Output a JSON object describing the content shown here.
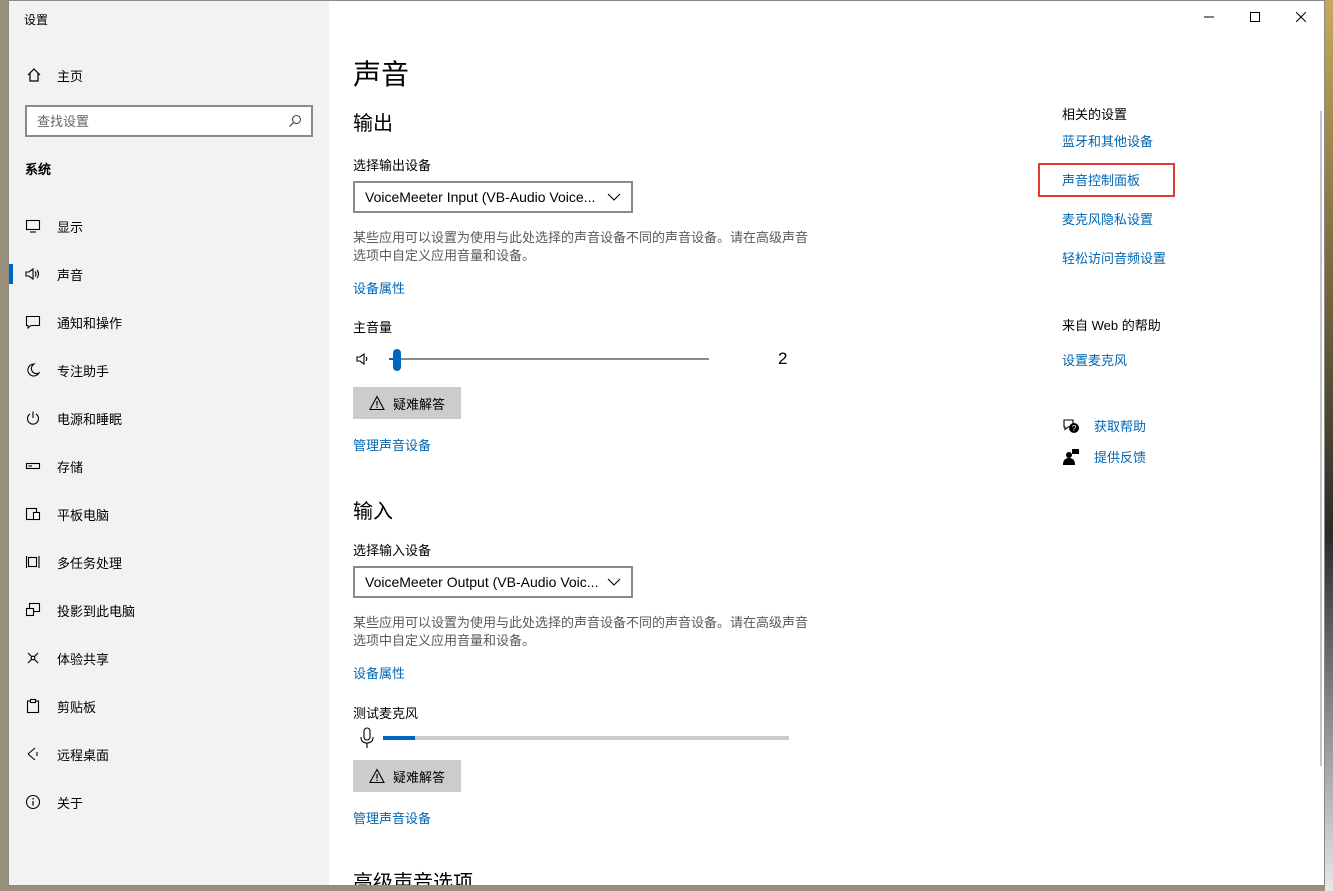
{
  "window": {
    "title": "设置",
    "minimize_icon": "minimize-icon",
    "maximize_icon": "maximize-icon",
    "close_icon": "close-icon"
  },
  "sidebar": {
    "home_label": "主页",
    "search_placeholder": "查找设置",
    "section_label": "系统",
    "items": [
      {
        "label": "显示",
        "icon": "display-icon"
      },
      {
        "label": "声音",
        "icon": "speaker-icon",
        "active": true
      },
      {
        "label": "通知和操作",
        "icon": "notification-icon"
      },
      {
        "label": "专注助手",
        "icon": "moon-icon"
      },
      {
        "label": "电源和睡眠",
        "icon": "power-icon"
      },
      {
        "label": "存储",
        "icon": "storage-icon"
      },
      {
        "label": "平板电脑",
        "icon": "tablet-icon"
      },
      {
        "label": "多任务处理",
        "icon": "multitask-icon"
      },
      {
        "label": "投影到此电脑",
        "icon": "project-icon"
      },
      {
        "label": "体验共享",
        "icon": "share-icon"
      },
      {
        "label": "剪贴板",
        "icon": "clipboard-icon"
      },
      {
        "label": "远程桌面",
        "icon": "remote-desktop-icon"
      },
      {
        "label": "关于",
        "icon": "info-icon"
      }
    ]
  },
  "main": {
    "page_title": "声音",
    "output": {
      "heading": "输出",
      "device_label": "选择输出设备",
      "device_value": "VoiceMeeter Input (VB-Audio Voice...",
      "description": "某些应用可以设置为使用与此处选择的声音设备不同的声音设备。请在高级声音选项中自定义应用音量和设备。",
      "device_properties": "设备属性",
      "master_volume_label": "主音量",
      "volume_value": "2",
      "volume_level_pct": 2,
      "troubleshoot": "疑难解答",
      "manage_devices": "管理声音设备"
    },
    "input": {
      "heading": "输入",
      "device_label": "选择输入设备",
      "device_value": "VoiceMeeter Output (VB-Audio Voic...",
      "description": "某些应用可以设置为使用与此处选择的声音设备不同的声音设备。请在高级声音选项中自定义应用音量和设备。",
      "device_properties": "设备属性",
      "test_mic_label": "测试麦克风",
      "mic_level_pct": 8,
      "troubleshoot": "疑难解答",
      "manage_devices": "管理声音设备"
    },
    "advanced_heading": "高级声音选项"
  },
  "related": {
    "title": "相关的设置",
    "links": [
      "蓝牙和其他设备",
      "声音控制面板",
      "麦克风隐私设置",
      "轻松访问音频设置"
    ],
    "web_help_title": "来自 Web 的帮助",
    "web_help_link": "设置麦克风",
    "get_help": "获取帮助",
    "feedback": "提供反馈"
  },
  "colors": {
    "accent": "#0067c0",
    "link": "#0066b4",
    "highlight": "#e53935"
  }
}
